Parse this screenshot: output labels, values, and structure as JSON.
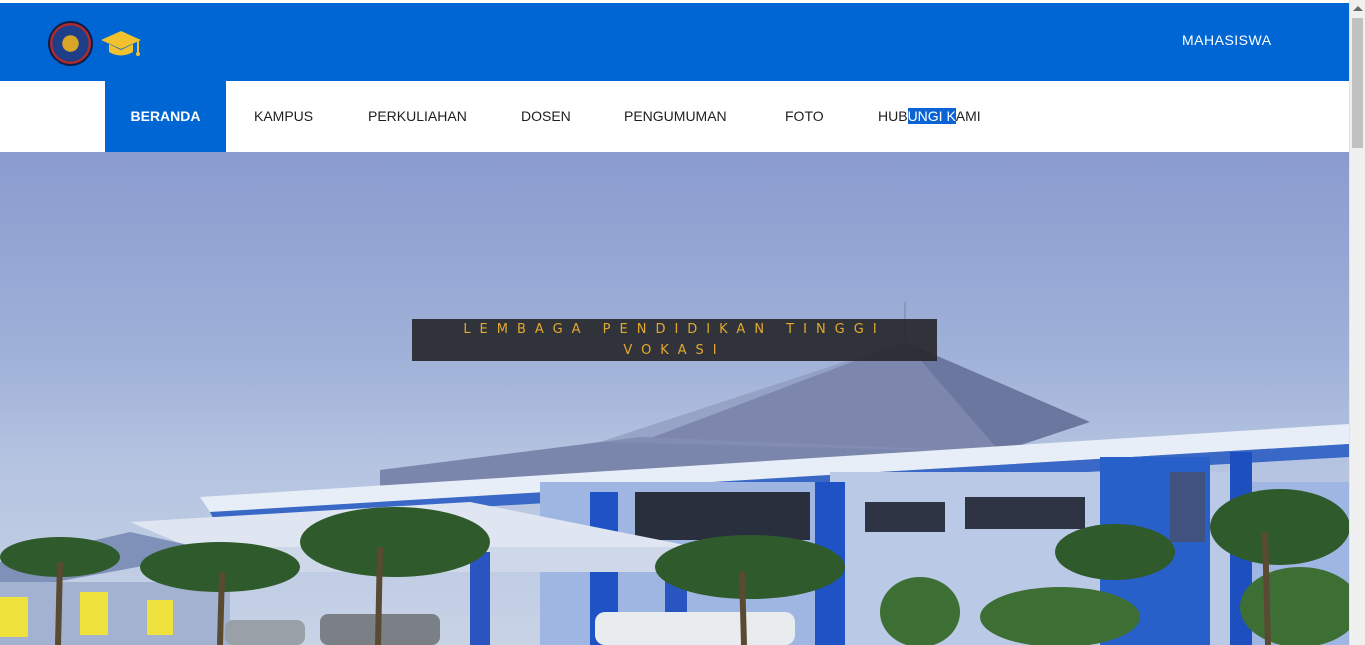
{
  "header": {
    "top_link": "MAHASISWA",
    "logo_seal_icon": "university-seal-icon",
    "logo_cap_icon": "graduation-cap-icon",
    "cap_color": "#f2c12e"
  },
  "nav": {
    "items": [
      {
        "label": "BERANDA",
        "active": true
      },
      {
        "label": "KAMPUS"
      },
      {
        "label": "PERKULIAHAN"
      },
      {
        "label": "DOSEN"
      },
      {
        "label": "PENGUMUMAN"
      },
      {
        "label": "FOTO"
      },
      {
        "label_pre": "HUB",
        "label_sel": "UNGI K",
        "label_post": "AMI"
      }
    ]
  },
  "hero": {
    "caption_line1": "LEMBAGA PENDIDIKAN TINGGI",
    "caption_line2": "VOKASI"
  },
  "colors": {
    "primary": "#0066d4",
    "caption_text": "#e4a82e"
  }
}
